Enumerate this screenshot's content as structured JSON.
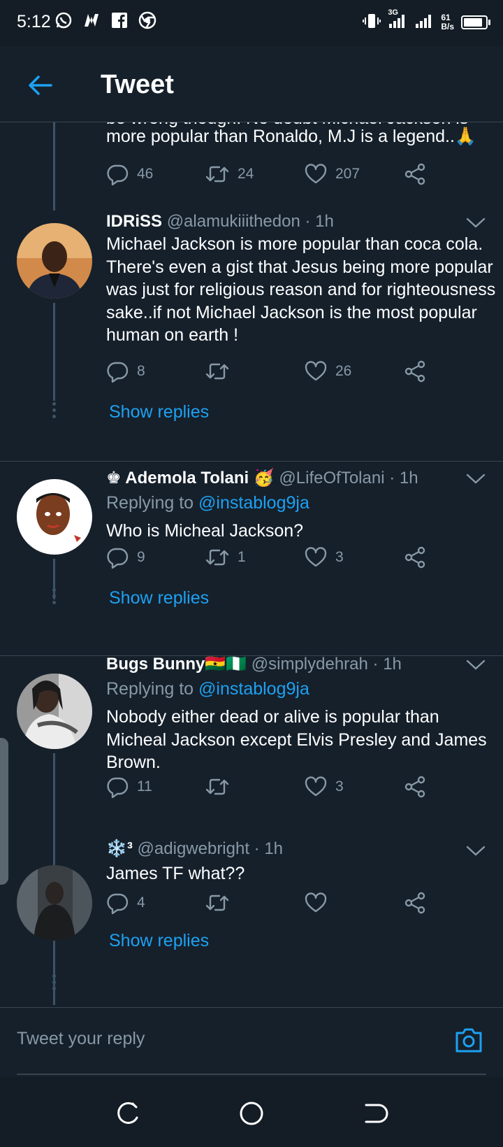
{
  "status_bar": {
    "time": "5:12",
    "net_speed_top": "61",
    "net_speed_bottom": "B/s",
    "network_type": "3G",
    "battery_level": 0.85
  },
  "header": {
    "title": "Tweet"
  },
  "partial_tweet": {
    "text_line_cut": "be wrong though. No doubt Michael Jackson is",
    "text": "more popular than Ronaldo, M.J is a legend..🙏",
    "replies": "46",
    "retweets": "24",
    "likes": "207"
  },
  "tweets": [
    {
      "name": "IDRiSS",
      "handle": "@alamukiiithedon",
      "time": "· 1h",
      "replying_label": "",
      "replying_handle": "",
      "text": "Michael Jackson is more popular than coca cola. There's even a gist that Jesus being more popular was just for religious reason and for righteousness sake..if not Michael Jackson is the most popular human on earth !",
      "replies": "8",
      "retweets": "",
      "likes": "26",
      "show_replies": "Show replies"
    },
    {
      "name": "♚ Ademola Tolani 🥳",
      "handle": "@LifeOfTolani",
      "time": "· 1h",
      "replying_label": "Replying to",
      "replying_handle": "@instablog9ja",
      "text": "Who is Micheal Jackson?",
      "replies": "9",
      "retweets": "1",
      "likes": "3",
      "show_replies": "Show replies"
    },
    {
      "name": "Bugs Bunny🇬🇭🇳🇬",
      "handle": "@simplydehrah",
      "time": "· 1h",
      "replying_label": "Replying to",
      "replying_handle": "@instablog9ja",
      "text": "Nobody either dead or alive is popular than Micheal Jackson except Elvis Presley and James Brown.",
      "replies": "11",
      "retweets": "",
      "likes": "3",
      "show_replies": ""
    },
    {
      "name": "❄️³",
      "handle": "@adigwebright",
      "time": "· 1h",
      "replying_label": "",
      "replying_handle": "",
      "text": "James TF what??",
      "replies": "4",
      "retweets": "",
      "likes": "",
      "show_replies": "Show replies"
    }
  ],
  "reply_bar": {
    "placeholder": "Tweet your reply"
  },
  "colors": {
    "background": "#15202b",
    "accent": "#1da1f2",
    "muted": "#8899a6",
    "divider": "#38444d"
  }
}
